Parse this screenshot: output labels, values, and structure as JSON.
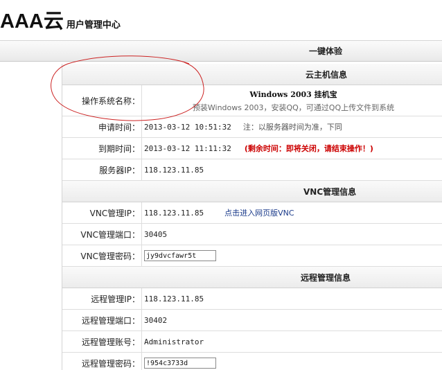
{
  "header": {
    "logo": "AAA云",
    "subtitle": "用户管理中心"
  },
  "top_bar": {
    "title": "一键体验"
  },
  "cloud_host": {
    "title": "云主机信息",
    "os_label": "操作系统名称：",
    "os_name": "Windows 2003 挂机宝",
    "os_desc": "预装Windows 2003，安装QQ，可通过QQ上传文件到系统",
    "apply_label": "申请时间：",
    "apply_time": "2013-03-12 10:51:32",
    "apply_note": "注：以服务器时间为准，下同",
    "expire_label": "到期时间：",
    "expire_time": "2013-03-12 11:11:32",
    "expire_warning": "(剩余时间：即将关闭，请结束操作！)",
    "server_ip_label": "服务器IP：",
    "server_ip": "118.123.11.85"
  },
  "vnc": {
    "title": "VNC管理信息",
    "ip_label": "VNC管理IP：",
    "ip": "118.123.11.85",
    "web_link": "点击进入网页版VNC",
    "port_label": "VNC管理端口：",
    "port": "30405",
    "password_label": "VNC管理密码：",
    "password": "jy9dvcfawr5t"
  },
  "remote": {
    "title": "远程管理信息",
    "ip_label": "远程管理IP：",
    "ip": "118.123.11.85",
    "port_label": "远程管理端口：",
    "port": "30402",
    "account_label": "远程管理账号：",
    "account": "Administrator",
    "password_label": "远程管理密码：",
    "password": "!954c3733d"
  },
  "annotation": {
    "color": "#cc2222"
  }
}
